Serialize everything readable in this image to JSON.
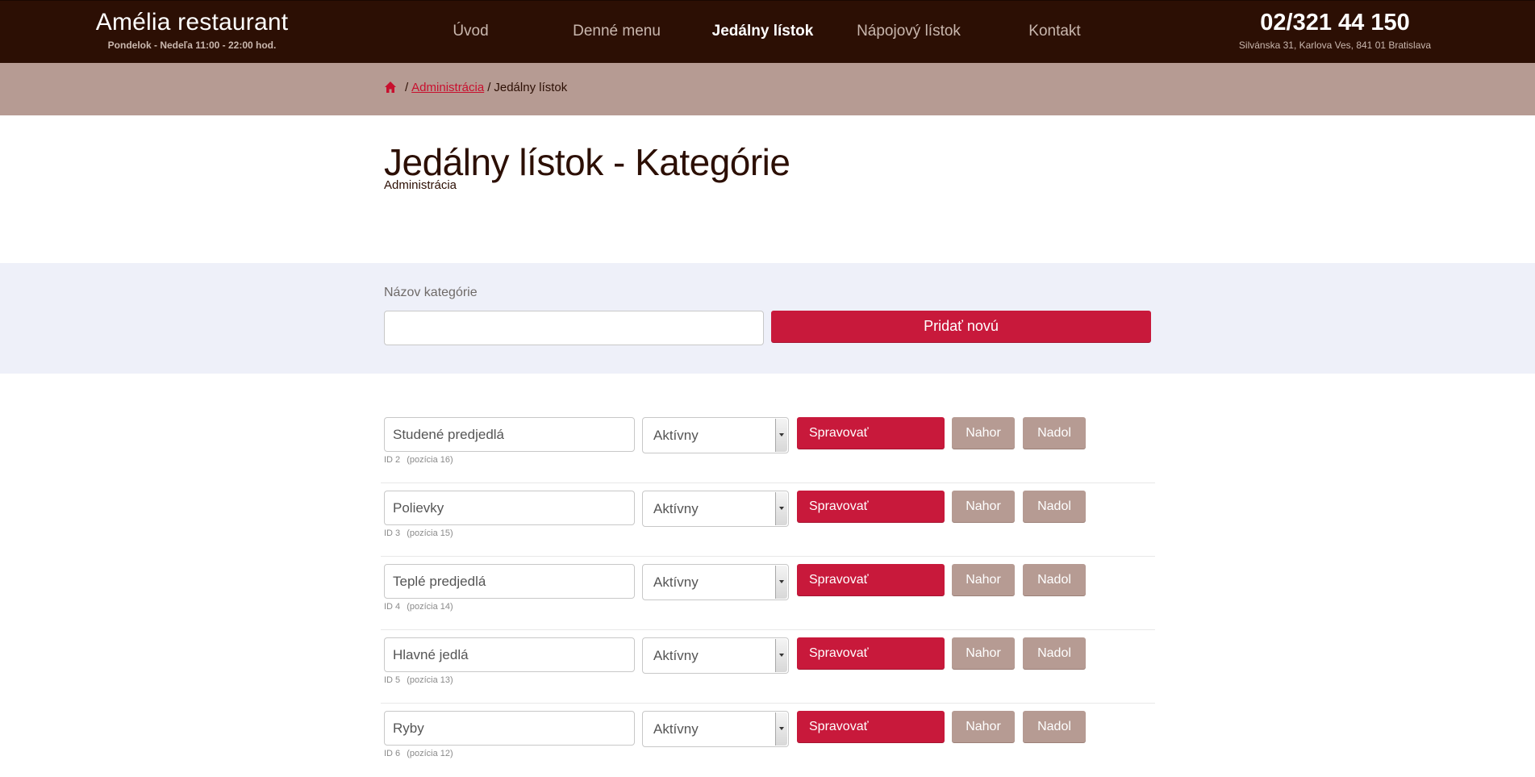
{
  "header": {
    "brand_name": "Amélia restaurant",
    "hours": "Pondelok - Nedeľa 11:00 - 22:00 hod.",
    "phone": "02/321 44 150",
    "address": "Silvánska 31, Karlova Ves, 841 01 Bratislava",
    "nav": [
      {
        "label": "Úvod",
        "active": false
      },
      {
        "label": "Denné menu",
        "active": false
      },
      {
        "label": "Jedálny lístok",
        "active": true
      },
      {
        "label": "Nápojový lístok",
        "active": false
      },
      {
        "label": "Kontakt",
        "active": false
      }
    ]
  },
  "breadcrumb": {
    "home_icon": "home-icon",
    "separator": "/",
    "link": "Administrácia",
    "current": "Jedálny lístok"
  },
  "page": {
    "title": "Jedálny lístok - Kategórie",
    "subtitle": "Administrácia"
  },
  "add_form": {
    "label": "Názov kategórie",
    "input_value": "",
    "button_label": "Pridať novú"
  },
  "categories": [
    {
      "name": "Studené predjedlá",
      "status": "Aktívny",
      "id_label": "ID 2",
      "position_label": "(pozícia 16)"
    },
    {
      "name": "Polievky",
      "status": "Aktívny",
      "id_label": "ID 3",
      "position_label": "(pozícia 15)"
    },
    {
      "name": "Teplé predjedlá",
      "status": "Aktívny",
      "id_label": "ID 4",
      "position_label": "(pozícia 14)"
    },
    {
      "name": "Hlavné jedlá",
      "status": "Aktívny",
      "id_label": "ID 5",
      "position_label": "(pozícia 13)"
    },
    {
      "name": "Ryby",
      "status": "Aktívny",
      "id_label": "ID 6",
      "position_label": "(pozícia 12)"
    }
  ],
  "row_actions": {
    "manage": "Spravovať",
    "up": "Nahor",
    "down": "Nadol"
  },
  "colors": {
    "topbar": "#2c0f04",
    "crumbbar": "#b69b93",
    "accent": "#c8193b",
    "secondary_button": "#b69b93",
    "form_band": "#eef0f9"
  }
}
